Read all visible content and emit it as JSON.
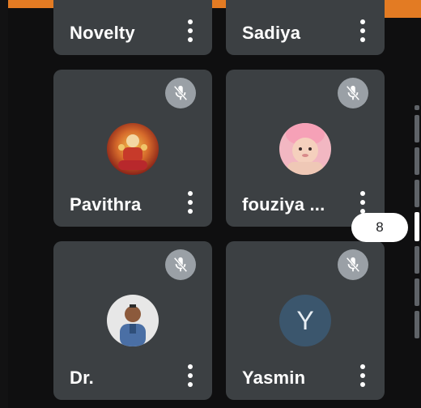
{
  "participants": [
    {
      "name": "Novelty"
    },
    {
      "name": "Sadiya"
    },
    {
      "name": "Pavithra"
    },
    {
      "name": "fouziya ..."
    },
    {
      "name": "Dr."
    },
    {
      "name": "Yasmin",
      "avatar_letter": "Y"
    }
  ],
  "scroll": {
    "page_indicator": "8"
  },
  "colors": {
    "tile_bg": "#3c4043",
    "mute_badge": "#9aa0a6",
    "accent_top": "#e37b23",
    "avatar_letter_bg": "#3b566d"
  },
  "icons": {
    "mute": "mic-off-icon",
    "more": "more-vert-icon"
  }
}
